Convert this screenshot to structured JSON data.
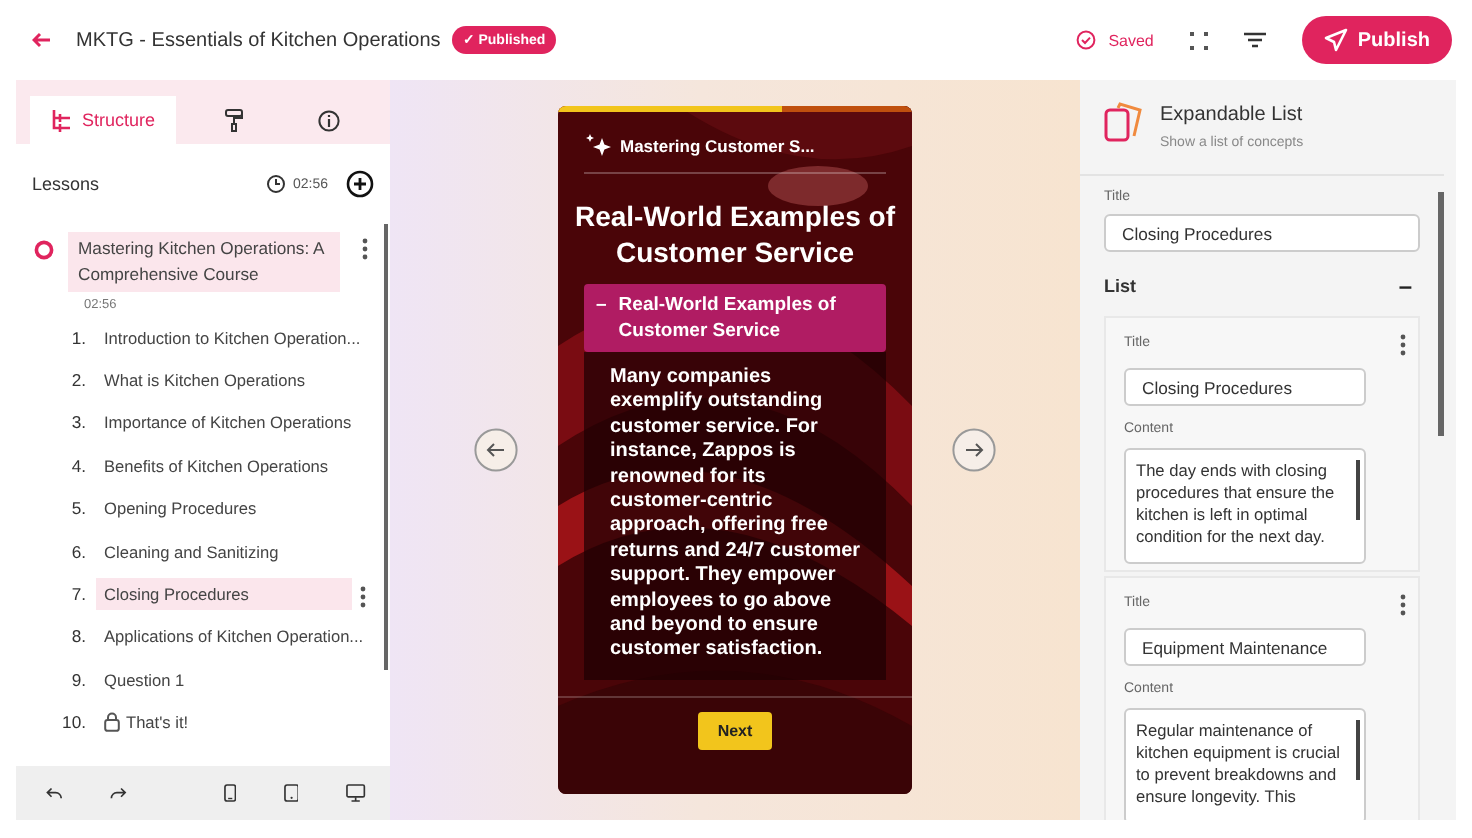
{
  "header": {
    "title": "MKTG - Essentials of Kitchen Operations",
    "badge": "✓ Published",
    "saved": "Saved",
    "publish": "Publish"
  },
  "sidebar": {
    "tabs": [
      {
        "kind": "structure",
        "label": "Structure",
        "selected": true
      },
      {
        "kind": "brush",
        "selected": false
      },
      {
        "kind": "info",
        "selected": false
      }
    ],
    "lessons_label": "Lessons",
    "duration": "02:56",
    "course": {
      "title": "Mastering Kitchen Operations: A Comprehensive Course",
      "time": "02:56",
      "selected": true
    },
    "lessons": [
      {
        "number": "1.",
        "title": "Introduction to Kitchen Operation...",
        "selected": false,
        "locked": false
      },
      {
        "number": "2.",
        "title": "What is Kitchen Operations",
        "selected": false,
        "locked": false
      },
      {
        "number": "3.",
        "title": "Importance of Kitchen Operations",
        "selected": false,
        "locked": false
      },
      {
        "number": "4.",
        "title": "Benefits of Kitchen Operations",
        "selected": false,
        "locked": false
      },
      {
        "number": "5.",
        "title": "Opening Procedures",
        "selected": false,
        "locked": false
      },
      {
        "number": "6.",
        "title": "Cleaning and Sanitizing",
        "selected": false,
        "locked": false
      },
      {
        "number": "7.",
        "title": "Closing Procedures",
        "selected": true,
        "locked": false
      },
      {
        "number": "8.",
        "title": "Applications of Kitchen Operation...",
        "selected": false,
        "locked": false
      },
      {
        "number": "9.",
        "title": "Question 1",
        "selected": false,
        "locked": false
      },
      {
        "number": "10.",
        "title": "That's it!",
        "selected": false,
        "locked": true
      }
    ]
  },
  "preview": {
    "course": "Mastering Customer S...",
    "progress": {
      "level": 0.63
    },
    "title": "Real-World Examples of Customer Service",
    "accordion": {
      "toggle": "–",
      "title": "Real-World Examples of Customer Service",
      "expanded": true,
      "body": "Many companies exemplify outstanding customer service. For instance, Zappos is renowned for its customer-centric approach, offering free returns and 24/7 customer support. They empower employees to go above and beyond to ensure customer satisfaction."
    },
    "next": "Next"
  },
  "properties": {
    "title": "Expandable List",
    "subtitle": "Show a list of concepts",
    "title_label": "Title",
    "title_value": "Closing Procedures",
    "list_label": "List",
    "list_toggle": "–",
    "items": [
      {
        "title_label": "Title",
        "title": "Closing Procedures",
        "content_label": "Content",
        "content": "The day ends with closing procedures that ensure the kitchen is left in optimal condition for the next day."
      },
      {
        "title_label": "Title",
        "title": "Equipment Maintenance",
        "content_label": "Content",
        "content": "Regular maintenance of kitchen equipment is crucial to prevent breakdowns and ensure longevity. This"
      }
    ]
  }
}
